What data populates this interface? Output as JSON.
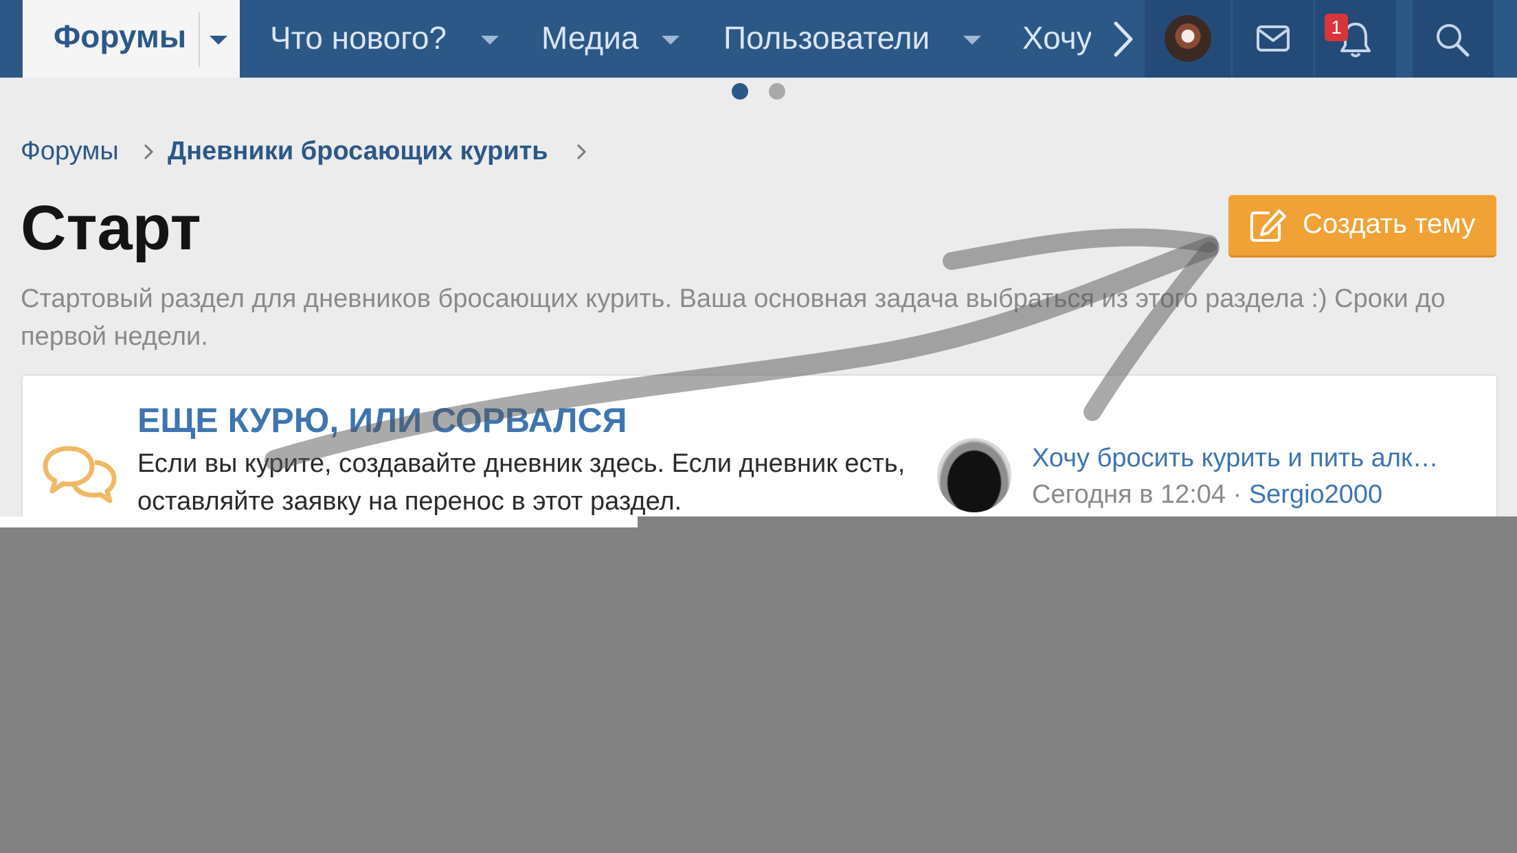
{
  "nav": {
    "active_tab": "Форумы",
    "items": [
      "Что нового?",
      "Медиа",
      "Пользователи",
      "Хочу"
    ],
    "notification_count": "1",
    "icons": {
      "dropdown": "chevron-down-icon",
      "next": "chevron-right-icon",
      "messages": "envelope-icon",
      "alerts": "bell-icon",
      "search": "search-icon"
    }
  },
  "breadcrumb": [
    "Форумы",
    "Дневники бросающих курить"
  ],
  "page": {
    "title": "Старт",
    "create_button": "Создать тему",
    "description": "Стартовый раздел для дневников бросающих курить. Ваша основная задача выбраться из этого раздела :) Сроки до первой недели."
  },
  "node": {
    "title": "ЕЩЕ КУРЮ, ИЛИ СОРВАЛСЯ",
    "description": "Если вы курите, создавайте дневник здесь. Если дневник есть, оставляйте заявку на перенос в этот раздел.",
    "icon": "chat-bubbles-icon",
    "last_post": {
      "title": "Хочу бросить курить и пить алк…",
      "time": "Сегодня в 12:04",
      "separator": " · ",
      "user": "Sergio2000"
    }
  },
  "colors": {
    "nav_bg": "#2c5888",
    "accent_orange": "#f0a236",
    "link_blue": "#3e75b0",
    "badge_red": "#d9343a"
  }
}
